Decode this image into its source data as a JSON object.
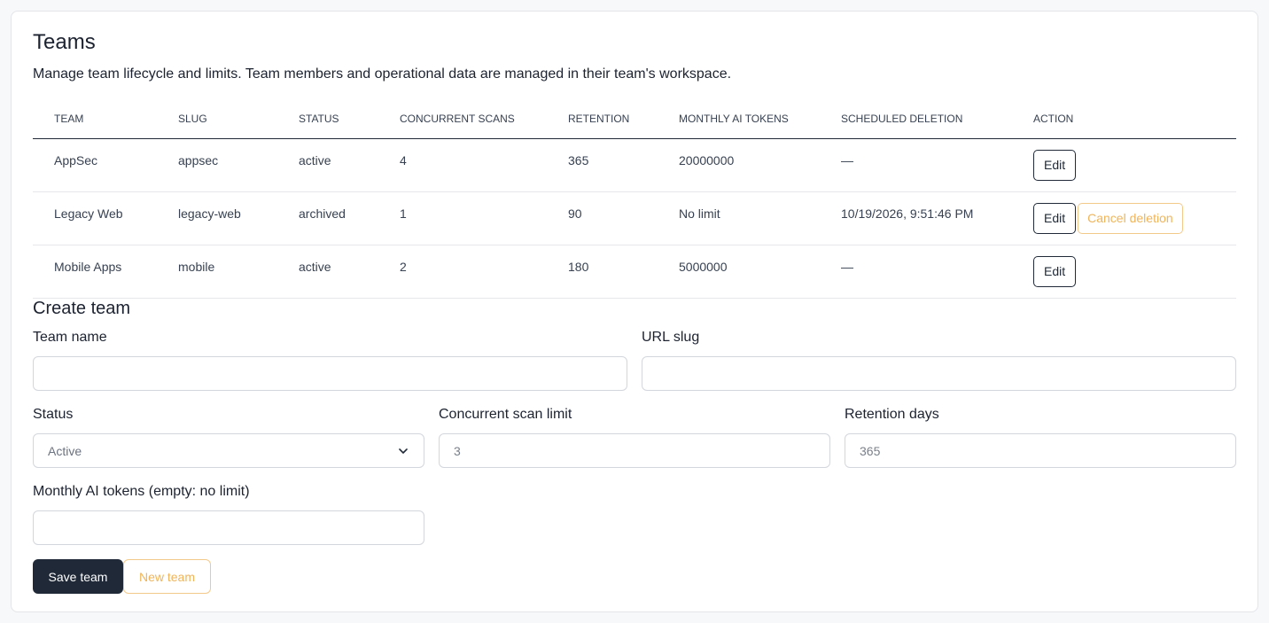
{
  "page": {
    "title": "Teams",
    "description": "Manage team lifecycle and limits. Team members and operational data are managed in their team's workspace."
  },
  "table": {
    "headers": [
      "TEAM",
      "SLUG",
      "STATUS",
      "CONCURRENT SCANS",
      "RETENTION",
      "MONTHLY AI TOKENS",
      "SCHEDULED DELETION",
      "ACTION"
    ],
    "rows": [
      {
        "team": "AppSec",
        "slug": "appsec",
        "status": "active",
        "scans": "4",
        "retention": "365",
        "tokens": "20000000",
        "deletion": "—",
        "edit_label": "Edit"
      },
      {
        "team": "Legacy Web",
        "slug": "legacy-web",
        "status": "archived",
        "scans": "1",
        "retention": "90",
        "tokens": "No limit",
        "deletion": "10/19/2026, 9:51:46 PM",
        "edit_label": "Edit",
        "cancel_label": "Cancel deletion"
      },
      {
        "team": "Mobile Apps",
        "slug": "mobile",
        "status": "active",
        "scans": "2",
        "retention": "180",
        "tokens": "5000000",
        "deletion": "—",
        "edit_label": "Edit"
      }
    ]
  },
  "create_form": {
    "title": "Create team",
    "team_name": {
      "label": "Team name",
      "value": "",
      "placeholder": ""
    },
    "url_slug": {
      "label": "URL slug",
      "value": "",
      "placeholder": ""
    },
    "status": {
      "label": "Status",
      "selected": "Active"
    },
    "concurrent": {
      "label": "Concurrent scan limit",
      "placeholder": "3"
    },
    "retention": {
      "label": "Retention days",
      "placeholder": "365"
    },
    "tokens": {
      "label": "Monthly AI tokens (empty: no limit)",
      "value": ""
    },
    "save_label": "Save team",
    "new_label": "New team"
  },
  "colors": {
    "primary": "#1f2937",
    "warning": "#f0b45a",
    "warning_border": "#f3c98a"
  },
  "icons": {
    "status_select": "chevron-down-icon"
  }
}
